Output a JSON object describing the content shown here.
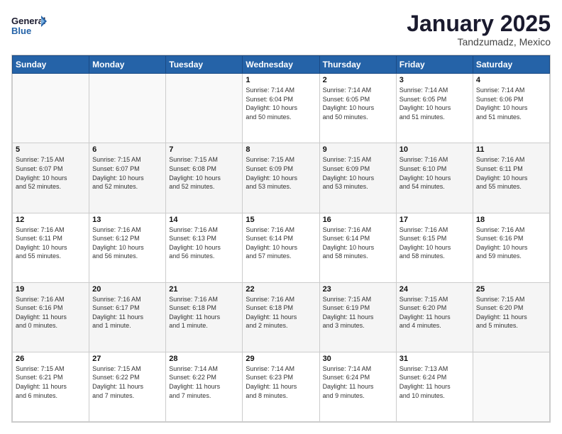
{
  "logo": {
    "line1": "General",
    "line2": "Blue"
  },
  "title": "January 2025",
  "location": "Tandzumadz, Mexico",
  "days_of_week": [
    "Sunday",
    "Monday",
    "Tuesday",
    "Wednesday",
    "Thursday",
    "Friday",
    "Saturday"
  ],
  "weeks": [
    [
      {
        "day": "",
        "info": ""
      },
      {
        "day": "",
        "info": ""
      },
      {
        "day": "",
        "info": ""
      },
      {
        "day": "1",
        "info": "Sunrise: 7:14 AM\nSunset: 6:04 PM\nDaylight: 10 hours\nand 50 minutes."
      },
      {
        "day": "2",
        "info": "Sunrise: 7:14 AM\nSunset: 6:05 PM\nDaylight: 10 hours\nand 50 minutes."
      },
      {
        "day": "3",
        "info": "Sunrise: 7:14 AM\nSunset: 6:05 PM\nDaylight: 10 hours\nand 51 minutes."
      },
      {
        "day": "4",
        "info": "Sunrise: 7:14 AM\nSunset: 6:06 PM\nDaylight: 10 hours\nand 51 minutes."
      }
    ],
    [
      {
        "day": "5",
        "info": "Sunrise: 7:15 AM\nSunset: 6:07 PM\nDaylight: 10 hours\nand 52 minutes."
      },
      {
        "day": "6",
        "info": "Sunrise: 7:15 AM\nSunset: 6:07 PM\nDaylight: 10 hours\nand 52 minutes."
      },
      {
        "day": "7",
        "info": "Sunrise: 7:15 AM\nSunset: 6:08 PM\nDaylight: 10 hours\nand 52 minutes."
      },
      {
        "day": "8",
        "info": "Sunrise: 7:15 AM\nSunset: 6:09 PM\nDaylight: 10 hours\nand 53 minutes."
      },
      {
        "day": "9",
        "info": "Sunrise: 7:15 AM\nSunset: 6:09 PM\nDaylight: 10 hours\nand 53 minutes."
      },
      {
        "day": "10",
        "info": "Sunrise: 7:16 AM\nSunset: 6:10 PM\nDaylight: 10 hours\nand 54 minutes."
      },
      {
        "day": "11",
        "info": "Sunrise: 7:16 AM\nSunset: 6:11 PM\nDaylight: 10 hours\nand 55 minutes."
      }
    ],
    [
      {
        "day": "12",
        "info": "Sunrise: 7:16 AM\nSunset: 6:11 PM\nDaylight: 10 hours\nand 55 minutes."
      },
      {
        "day": "13",
        "info": "Sunrise: 7:16 AM\nSunset: 6:12 PM\nDaylight: 10 hours\nand 56 minutes."
      },
      {
        "day": "14",
        "info": "Sunrise: 7:16 AM\nSunset: 6:13 PM\nDaylight: 10 hours\nand 56 minutes."
      },
      {
        "day": "15",
        "info": "Sunrise: 7:16 AM\nSunset: 6:14 PM\nDaylight: 10 hours\nand 57 minutes."
      },
      {
        "day": "16",
        "info": "Sunrise: 7:16 AM\nSunset: 6:14 PM\nDaylight: 10 hours\nand 58 minutes."
      },
      {
        "day": "17",
        "info": "Sunrise: 7:16 AM\nSunset: 6:15 PM\nDaylight: 10 hours\nand 58 minutes."
      },
      {
        "day": "18",
        "info": "Sunrise: 7:16 AM\nSunset: 6:16 PM\nDaylight: 10 hours\nand 59 minutes."
      }
    ],
    [
      {
        "day": "19",
        "info": "Sunrise: 7:16 AM\nSunset: 6:16 PM\nDaylight: 11 hours\nand 0 minutes."
      },
      {
        "day": "20",
        "info": "Sunrise: 7:16 AM\nSunset: 6:17 PM\nDaylight: 11 hours\nand 1 minute."
      },
      {
        "day": "21",
        "info": "Sunrise: 7:16 AM\nSunset: 6:18 PM\nDaylight: 11 hours\nand 1 minute."
      },
      {
        "day": "22",
        "info": "Sunrise: 7:16 AM\nSunset: 6:18 PM\nDaylight: 11 hours\nand 2 minutes."
      },
      {
        "day": "23",
        "info": "Sunrise: 7:15 AM\nSunset: 6:19 PM\nDaylight: 11 hours\nand 3 minutes."
      },
      {
        "day": "24",
        "info": "Sunrise: 7:15 AM\nSunset: 6:20 PM\nDaylight: 11 hours\nand 4 minutes."
      },
      {
        "day": "25",
        "info": "Sunrise: 7:15 AM\nSunset: 6:20 PM\nDaylight: 11 hours\nand 5 minutes."
      }
    ],
    [
      {
        "day": "26",
        "info": "Sunrise: 7:15 AM\nSunset: 6:21 PM\nDaylight: 11 hours\nand 6 minutes."
      },
      {
        "day": "27",
        "info": "Sunrise: 7:15 AM\nSunset: 6:22 PM\nDaylight: 11 hours\nand 7 minutes."
      },
      {
        "day": "28",
        "info": "Sunrise: 7:14 AM\nSunset: 6:22 PM\nDaylight: 11 hours\nand 7 minutes."
      },
      {
        "day": "29",
        "info": "Sunrise: 7:14 AM\nSunset: 6:23 PM\nDaylight: 11 hours\nand 8 minutes."
      },
      {
        "day": "30",
        "info": "Sunrise: 7:14 AM\nSunset: 6:24 PM\nDaylight: 11 hours\nand 9 minutes."
      },
      {
        "day": "31",
        "info": "Sunrise: 7:13 AM\nSunset: 6:24 PM\nDaylight: 11 hours\nand 10 minutes."
      },
      {
        "day": "",
        "info": ""
      }
    ]
  ]
}
